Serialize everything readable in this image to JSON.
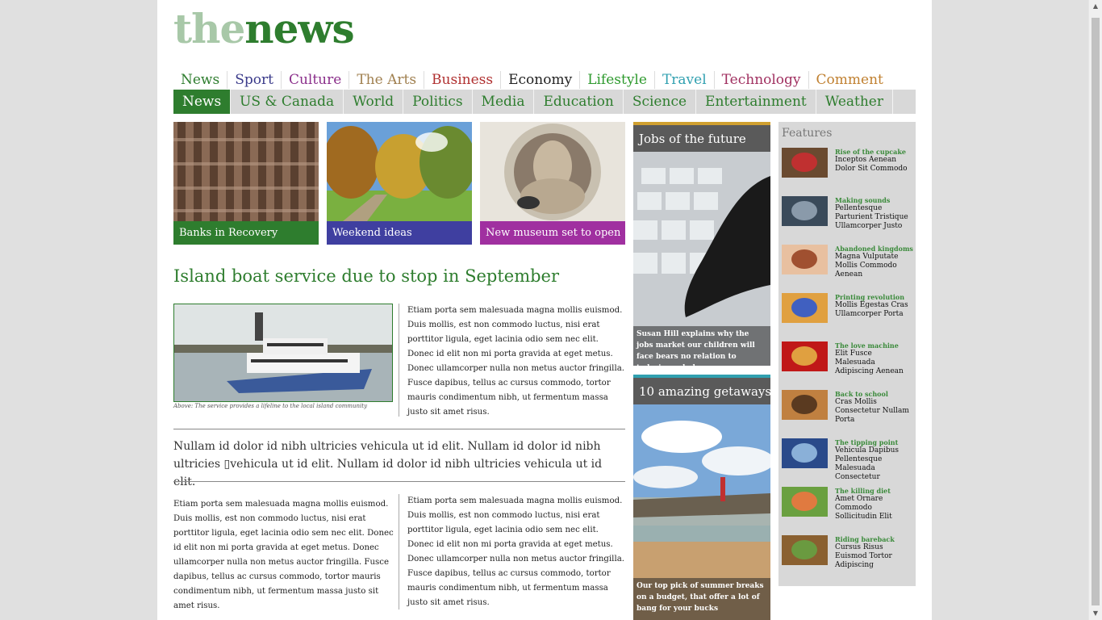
{
  "logo": {
    "part1": "the",
    "part2": "news"
  },
  "top_nav": [
    {
      "label": "News",
      "color": "#2e7d2e"
    },
    {
      "label": "Sport",
      "color": "#3a3a8a"
    },
    {
      "label": "Culture",
      "color": "#8a2e8a"
    },
    {
      "label": "The Arts",
      "color": "#a08050"
    },
    {
      "label": "Business",
      "color": "#b03030"
    },
    {
      "label": "Economy",
      "color": "#222222"
    },
    {
      "label": "Lifestyle",
      "color": "#2e9a2e"
    },
    {
      "label": "Travel",
      "color": "#30a0b0"
    },
    {
      "label": "Technology",
      "color": "#a03060"
    },
    {
      "label": "Comment",
      "color": "#c08030"
    }
  ],
  "sub_nav": [
    "News",
    "US & Canada",
    "World",
    "Politics",
    "Media",
    "Education",
    "Science",
    "Entertainment",
    "Weather"
  ],
  "tiles": [
    {
      "caption": "Banks in Recovery",
      "color": "#2e7d2e"
    },
    {
      "caption": "Weekend ideas",
      "color": "#3f3fa0"
    },
    {
      "caption": "New museum set to open",
      "color": "#a030a0"
    }
  ],
  "main_story": {
    "headline": "Island boat service due to stop in September",
    "photo_caption": "Above: The service provides a lifeline to the local island community",
    "para1": "Etiam porta sem malesuada magna mollis euismod. Duis mollis, est non commodo luctus, nisi erat porttitor ligula, eget lacinia odio sem nec elit. Donec id elit non mi porta gravida at eget metus. Donec ullamcorper nulla non metus auctor fringilla. Fusce dapibus, tellus ac cursus commodo, tortor mauris condimentum nibh, ut fermentum massa justo sit amet risus.",
    "quote": "Nullam id dolor id nibh ultricies vehicula ut id elit. Nullam id dolor id nibh ultricies ▯vehicula ut id elit. Nullam id dolor id nibh ultricies vehicula ut id elit.",
    "col_left": "Etiam porta sem malesuada magna mollis euismod. Duis mollis, est non commodo luctus, nisi erat porttitor ligula, eget lacinia odio sem nec elit. Donec id elit non mi porta gravida at eget metus. Donec ullamcorper nulla non metus auctor fringilla. Fusce dapibus, tellus ac cursus commodo, tortor mauris condimentum nibh, ut fermentum massa justo sit amet risus.",
    "col_right": "Etiam porta sem malesuada magna mollis euismod. Duis mollis, est non commodo luctus, nisi erat porttitor ligula, eget lacinia odio sem nec elit. Donec id elit non mi porta gravida at eget metus. Donec ullamcorper nulla non metus auctor fringilla. Fusce dapibus, tellus ac cursus commodo, tortor mauris condimentum nibh, ut fermentum massa justo sit amet risus."
  },
  "side_boxes": [
    {
      "label": "Jobs of the future",
      "caption": "Susan Hill explains why the jobs market our children will face bears no relation to today's workplace",
      "bar_color": "#d0a030"
    },
    {
      "label": "10 amazing getaways",
      "caption": "Our top pick of summer breaks on a budget, that offer a lot of bang for your bucks",
      "bar_color": "#30a0b0"
    }
  ],
  "features": {
    "title": "Features",
    "items": [
      {
        "kicker": "Rise of the cupcake",
        "text": "Inceptos Aenean Dolor Sit Commodo"
      },
      {
        "kicker": "Making sounds",
        "text": "Pellentesque Parturient Tristique Ullamcorper Justo"
      },
      {
        "kicker": "Abandoned kingdoms",
        "text": "Magna Vulputate Mollis Commodo Aenean"
      },
      {
        "kicker": "Printing revolution",
        "text": "Mollis Egestas Cras Ullamcorper Porta"
      },
      {
        "kicker": "The love machine",
        "text": "Elit Fusce Malesuada Adipiscing Aenean"
      },
      {
        "kicker": "Back to school",
        "text": "Cras Mollis Consectetur Nullam Porta"
      },
      {
        "kicker": "The tipping point",
        "text": "Vehicula Dapibus Pellentesque Malesuada Consectetur"
      },
      {
        "kicker": "The killing diet",
        "text": "Amet Ornare Commodo Sollicitudin Elit"
      },
      {
        "kicker": "Riding bareback",
        "text": "Cursus Risus Euismod Tortor Adipiscing"
      }
    ]
  }
}
